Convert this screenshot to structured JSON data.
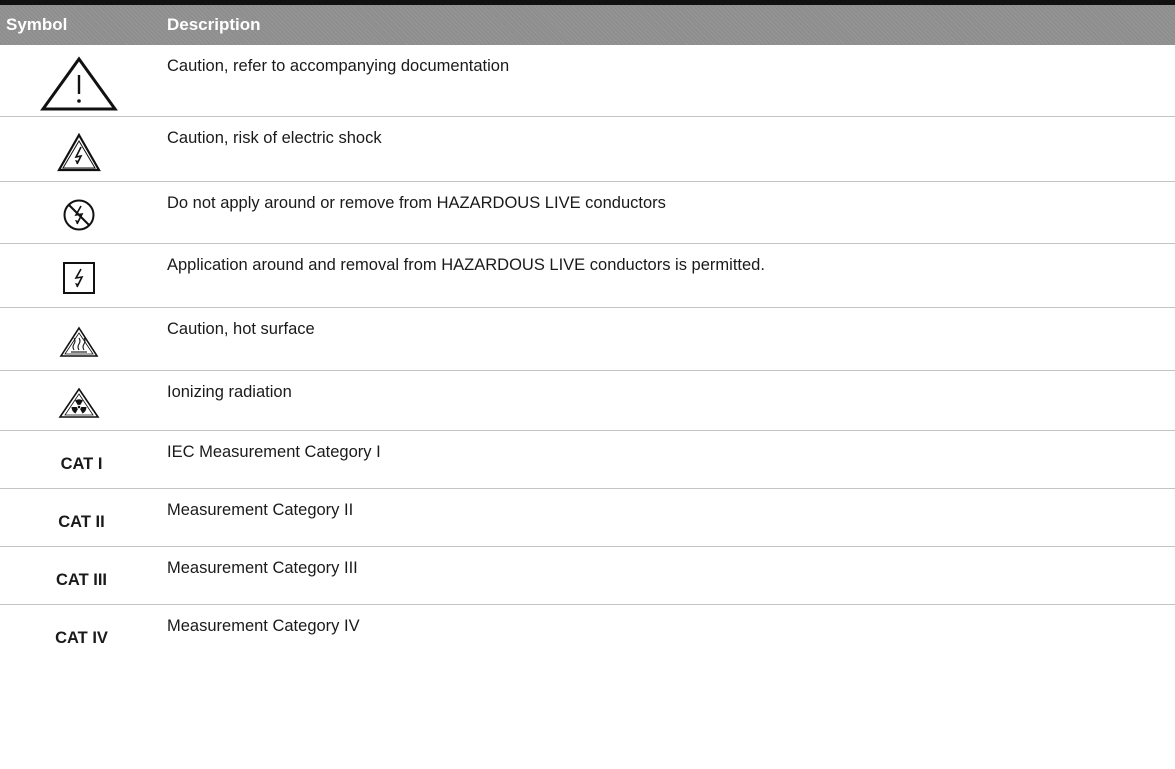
{
  "header": {
    "symbol_label": "Symbol",
    "description_label": "Description"
  },
  "rows": [
    {
      "icon": "caution-warning-triangle-icon",
      "description": "Caution, refer to accompanying documentation"
    },
    {
      "icon": "electric-shock-triangle-icon",
      "description": "Caution, risk of electric shock"
    },
    {
      "icon": "no-live-conductor-icon",
      "description": "Do not apply around or remove from HAZARDOUS LIVE conductors"
    },
    {
      "icon": "live-conductor-permitted-icon",
      "description": "Application around and removal from HAZARDOUS LIVE conductors is permitted."
    },
    {
      "icon": "hot-surface-triangle-icon",
      "description": "Caution, hot surface"
    },
    {
      "icon": "ionizing-radiation-triangle-icon",
      "description": "Ionizing radiation"
    },
    {
      "symbol": "CAT I",
      "description": "IEC Measurement Category I"
    },
    {
      "symbol": "CAT II",
      "description": "Measurement Category II"
    },
    {
      "symbol": "CAT III",
      "description": "Measurement Category III"
    },
    {
      "symbol": "CAT IV",
      "description": "Measurement Category IV"
    }
  ]
}
